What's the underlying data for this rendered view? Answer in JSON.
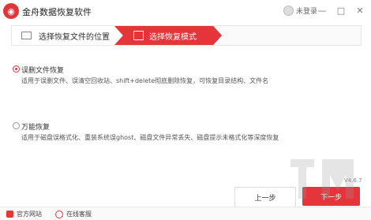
{
  "title": "金舟数据恢复软件",
  "login_label": "未登录",
  "window_controls": {
    "minimize": "—",
    "maximize": "□",
    "close": "✕"
  },
  "steps": [
    {
      "label": "选择恢复文件的位置"
    },
    {
      "label": "选择恢复模式"
    }
  ],
  "options": [
    {
      "label": "误删文件恢复",
      "description": "适用于误删文件、误清空回收站、shift+delete彻底删除恢复，可恢复目录结构、文件名",
      "selected": true
    },
    {
      "label": "万能恢复",
      "description": "适用于磁盘误格式化、重装系统误ghost、磁盘文件异常丢失、磁盘提示未格式化等深度恢复",
      "selected": false
    }
  ],
  "buttons": {
    "prev": "上一步",
    "next": "下一步"
  },
  "version": "V4.6.7",
  "footer": {
    "website": "官方网站",
    "service": "在线客服"
  },
  "colors": {
    "accent": "#e5353a"
  }
}
